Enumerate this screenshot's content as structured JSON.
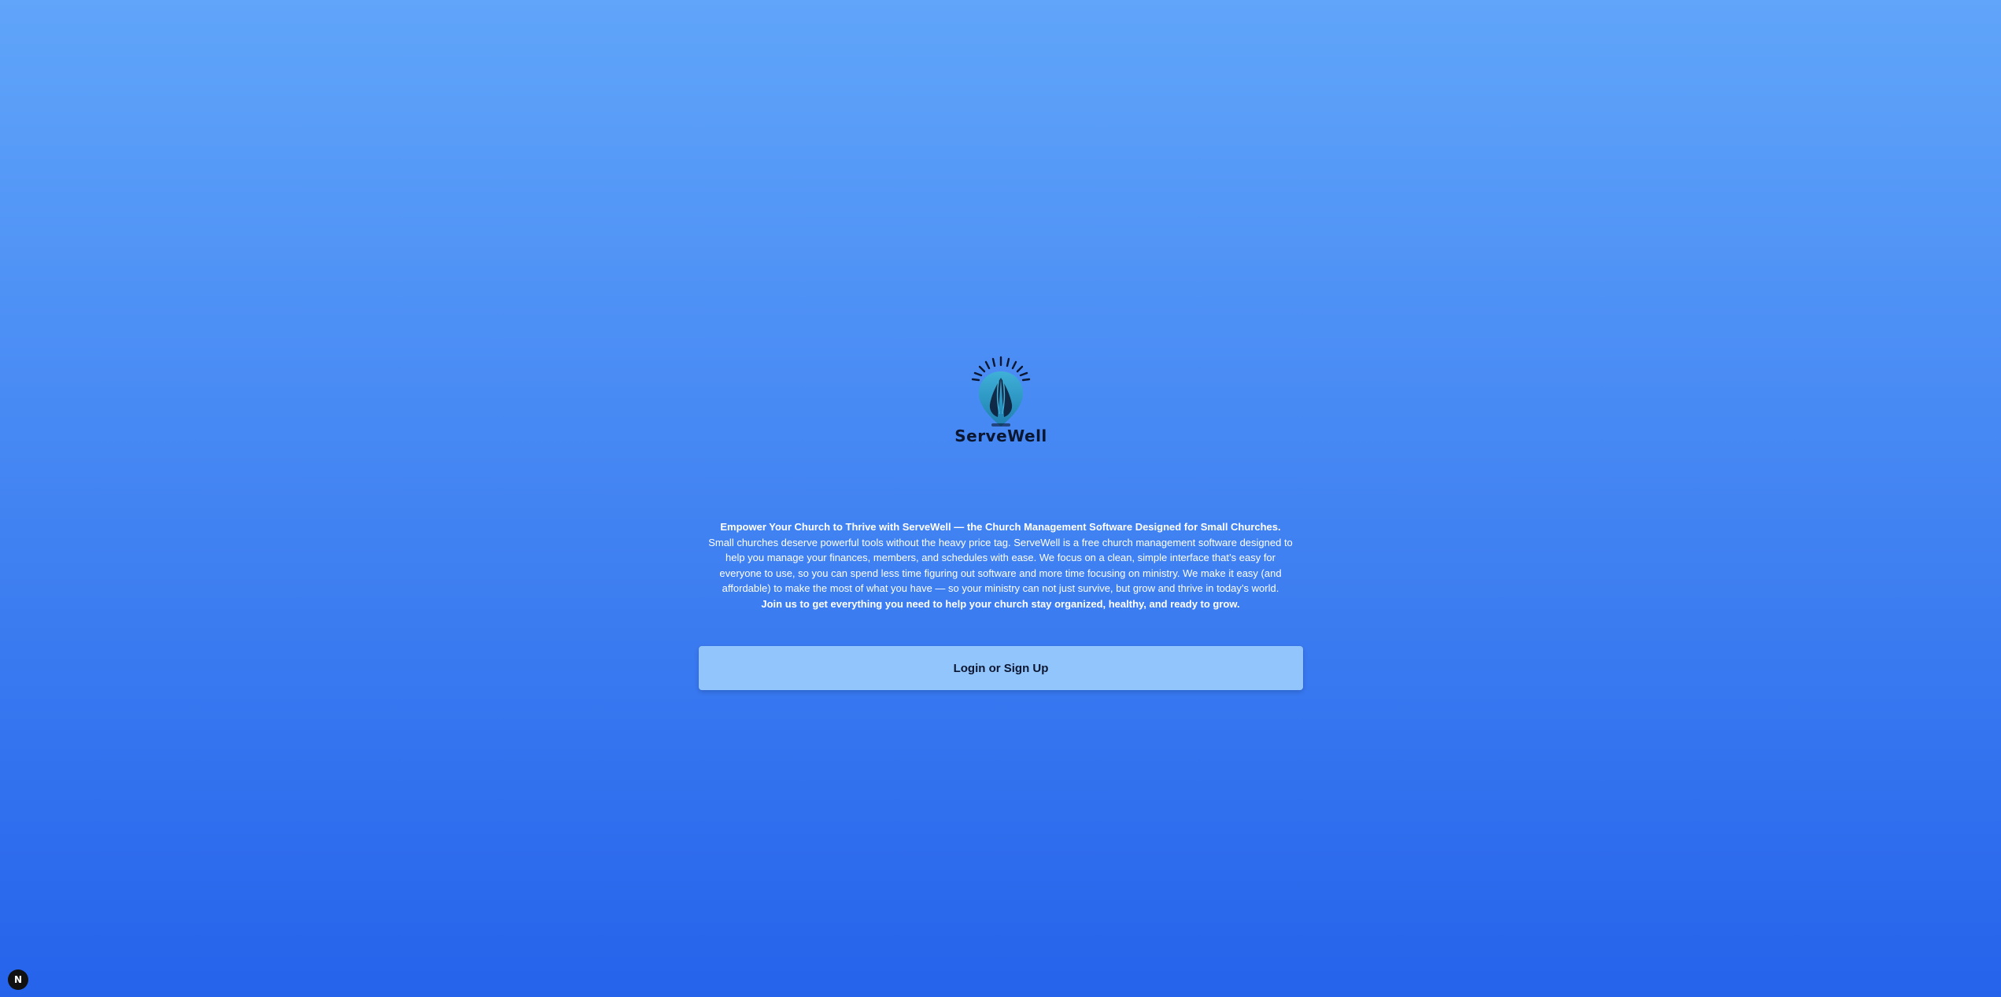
{
  "brand": {
    "name": "ServeWell",
    "logo_icon": "praying-hands-sunburst-icon"
  },
  "intro": {
    "headline": "Empower Your Church to Thrive with ServeWell — the Church Management Software Designed for Small Churches.",
    "body": "Small churches deserve powerful tools without the heavy price tag. ServeWell is a free church management software designed to help you manage your finances, members, and schedules with ease. We focus on a clean, simple interface that’s easy for everyone to use, so you can spend less time figuring out software and more time focusing on ministry. We make it easy (and affordable) to make the most of what you have — so your ministry can not just survive, but grow and thrive in today’s world.",
    "closing": "Join us to get everything you need to help your church stay organized, healthy, and ready to grow."
  },
  "cta": {
    "label": "Login or Sign Up"
  },
  "dev_badge": {
    "letter": "N",
    "icon": "nextjs-icon"
  },
  "colors": {
    "gradient_top": "#60a5fa",
    "gradient_bottom": "#2563eb",
    "button_bg": "#93c5fd",
    "text_dark": "#0b1630"
  }
}
